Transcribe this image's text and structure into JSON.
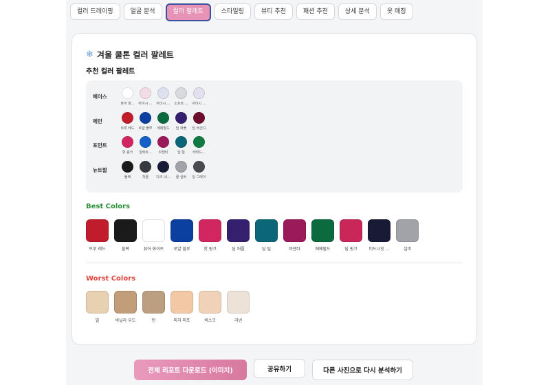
{
  "tabs": [
    {
      "label": "컬러 드레이핑",
      "active": false
    },
    {
      "label": "얼굴 분석",
      "active": false
    },
    {
      "label": "컬러 팔레트",
      "active": true
    },
    {
      "label": "스타일링",
      "active": false
    },
    {
      "label": "뷰티 추천",
      "active": false
    },
    {
      "label": "패션 추천",
      "active": false
    },
    {
      "label": "상세 분석",
      "active": false
    },
    {
      "label": "옷 매칭",
      "active": false
    }
  ],
  "card": {
    "icon": "❄",
    "title": "겨울 쿨톤 컬러 팔레트",
    "subtitle": "추천 컬러 팔레트"
  },
  "palette_rows": [
    {
      "label": "베이스",
      "items": [
        {
          "name": "퓨어 화...",
          "color": "#ffffff"
        },
        {
          "name": "아이시 ...",
          "color": "#f1dde3"
        },
        {
          "name": "아이시 ...",
          "color": "#dde2ee"
        },
        {
          "name": "소프트 ...",
          "color": "#d9dadd"
        },
        {
          "name": "아이시 ...",
          "color": "#e3e0ef"
        }
      ]
    },
    {
      "label": "메인",
      "items": [
        {
          "name": "트루 레드",
          "color": "#c01c2c"
        },
        {
          "name": "로얄 블루",
          "color": "#0b3fa0"
        },
        {
          "name": "에메랄드",
          "color": "#0c6a3f"
        },
        {
          "name": "딥 퍼플",
          "color": "#352070"
        },
        {
          "name": "딥 버건디",
          "color": "#6e0e2c"
        }
      ]
    },
    {
      "label": "포인트",
      "items": [
        {
          "name": "핫 핑크",
          "color": "#d12660"
        },
        {
          "name": "일렉트...",
          "color": "#1560c8"
        },
        {
          "name": "마젠타",
          "color": "#9b1a5a"
        },
        {
          "name": "딥 틸",
          "color": "#0b6678"
        },
        {
          "name": "비비드...",
          "color": "#0f7a42"
        }
      ]
    },
    {
      "label": "뉴트럴",
      "items": [
        {
          "name": "블랙",
          "color": "#1a1a1a"
        },
        {
          "name": "차콜",
          "color": "#36393f"
        },
        {
          "name": "다크 네...",
          "color": "#171b36"
        },
        {
          "name": "쿨 실버",
          "color": "#a2a3a8"
        },
        {
          "name": "딥 그레이",
          "color": "#4a4b50"
        }
      ]
    }
  ],
  "best": {
    "title": "Best Colors",
    "items": [
      {
        "name": "트루 레드",
        "color": "#c01c2c"
      },
      {
        "name": "블랙",
        "color": "#1a1a1a"
      },
      {
        "name": "퓨어 화이트",
        "color": "#ffffff"
      },
      {
        "name": "로얄 블루",
        "color": "#0b3fa0"
      },
      {
        "name": "핫 핑크",
        "color": "#d12660"
      },
      {
        "name": "딥 퍼플",
        "color": "#352070"
      },
      {
        "name": "딥 틸",
        "color": "#0b6678"
      },
      {
        "name": "마젠타",
        "color": "#9b1a5a"
      },
      {
        "name": "에메랄드",
        "color": "#0c6a3f"
      },
      {
        "name": "딥 핑크",
        "color": "#c9265a"
      },
      {
        "name": "미드나잇 ...",
        "color": "#171b36"
      },
      {
        "name": "실버",
        "color": "#a2a3a8"
      }
    ]
  },
  "worst": {
    "title": "Worst Colors",
    "items": [
      {
        "name": "밀",
        "color": "#e8d1b0"
      },
      {
        "name": "바닐라 우드",
        "color": "#c29d7a"
      },
      {
        "name": "탄",
        "color": "#bb9f80"
      },
      {
        "name": "피치 퍼프",
        "color": "#f2c8a5"
      },
      {
        "name": "비스크",
        "color": "#f0d2b8"
      },
      {
        "name": "리넨",
        "color": "#ede2d8"
      }
    ]
  },
  "buttons": {
    "download": "전체 리포트 다운로드 (이미지)",
    "share": "공유하기",
    "reanalyze": "다른 사진으로 다시 분석하기"
  }
}
